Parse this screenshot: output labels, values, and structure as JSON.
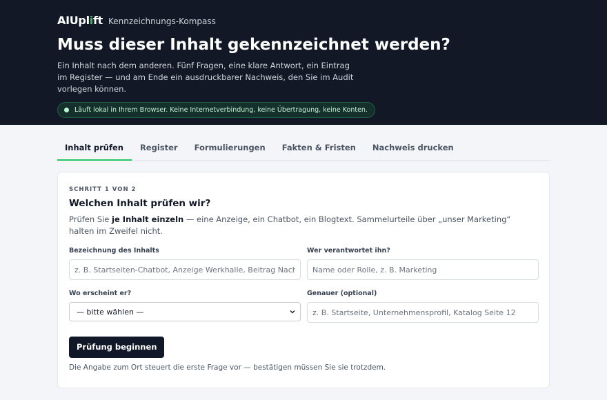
{
  "header": {
    "brand_prefix": "AIUpl",
    "brand_accent": "i",
    "brand_suffix": "ft",
    "subtitle": "Kennzeichnungs-Kompass",
    "title": "Muss dieser Inhalt gekennzeichnet werden?",
    "description": "Ein Inhalt nach dem anderen. Fünf Fragen, eine klare Antwort, ein Eintrag im Register — und am Ende ein ausdruckbarer Nachweis, den Sie im Audit vorlegen können.",
    "privacy_note": "Läuft lokal in Ihrem Browser. Keine Internetverbindung, keine Übertragung, keine Konten."
  },
  "tabs": [
    {
      "label": "Inhalt prüfen",
      "active": true
    },
    {
      "label": "Register"
    },
    {
      "label": "Formulierungen"
    },
    {
      "label": "Fakten & Fristen"
    },
    {
      "label": "Nachweis drucken"
    }
  ],
  "card": {
    "step": "SCHRITT 1 VON 2",
    "title": "Welchen Inhalt prüfen wir?",
    "lead_pre": "Prüfen Sie ",
    "lead_bold": "je Inhalt einzeln",
    "lead_post": " — eine Anzeige, ein Chatbot, ein Blogtext. Sammelurteile über „unser Marketing“ halten im Zweifel nicht.",
    "fields": {
      "name_label": "Bezeichnung des Inhalts",
      "name_placeholder": "z. B. Startseiten-Chatbot, Anzeige Werkhalle, Beitrag Nachhaltigkeit",
      "owner_label": "Wer verantwortet ihn?",
      "owner_placeholder": "Name oder Rolle, z. B. Marketing",
      "where_label": "Wo erscheint er?",
      "where_value": "— bitte wählen —",
      "detail_label": "Genauer (optional)",
      "detail_placeholder": "z. B. Startseite, Unternehmensprofil, Katalog Seite 12"
    },
    "submit_label": "Prüfung beginnen",
    "hint": "Die Angabe zum Ort steuert die erste Frage vor — bestätigen müssen Sie sie trotzdem."
  },
  "colors": {
    "hero_bg": "#121826",
    "accent": "#22c55e",
    "button_bg": "#111827"
  }
}
